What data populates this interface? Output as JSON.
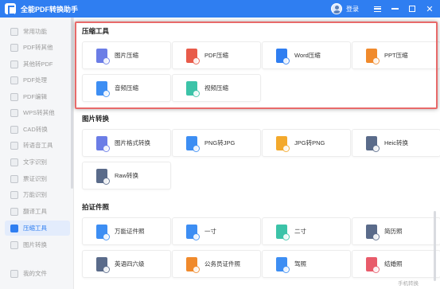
{
  "window": {
    "title": "全能PDF转换助手",
    "login_label": "登录",
    "colors": {
      "titlebar": "#2f7ef1",
      "highlight": "#e86a6a",
      "active": "#2f7ef1"
    }
  },
  "sidebar": {
    "items": [
      {
        "label": "常用功能",
        "icon": "star-icon"
      },
      {
        "label": "PDF转其他",
        "icon": "pdf-export-icon"
      },
      {
        "label": "其他转PDF",
        "icon": "pdf-import-icon"
      },
      {
        "label": "PDF处理",
        "icon": "pdf-process-icon"
      },
      {
        "label": "PDF编辑",
        "icon": "pdf-edit-icon"
      },
      {
        "label": "WPS转其他",
        "icon": "wps-icon"
      },
      {
        "label": "CAD转换",
        "icon": "cad-icon"
      },
      {
        "label": "转语音工具",
        "icon": "voice-icon"
      },
      {
        "label": "文字识别",
        "icon": "ocr-icon"
      },
      {
        "label": "票证识别",
        "icon": "ticket-icon"
      },
      {
        "label": "万能识别",
        "icon": "scan-icon"
      },
      {
        "label": "翻译工具",
        "icon": "translate-icon"
      },
      {
        "label": "压缩工具",
        "icon": "compress-icon",
        "active": true
      },
      {
        "label": "图片转换",
        "icon": "image-convert-icon"
      },
      {
        "label": "我的文件",
        "icon": "folder-icon"
      }
    ]
  },
  "sections": {
    "compress": {
      "title": "压缩工具",
      "cards": [
        {
          "label": "图片压缩",
          "icon": "image-compress-icon",
          "color": "#6b7de6",
          "tag": ""
        },
        {
          "label": "PDF压缩",
          "icon": "pdf-compress-icon",
          "color": "#e85b4a",
          "tag": ""
        },
        {
          "label": "Word压缩",
          "icon": "word-compress-icon",
          "color": "#2f7ef1",
          "tag": "W"
        },
        {
          "label": "PPT压缩",
          "icon": "ppt-compress-icon",
          "color": "#f08a2c",
          "tag": "P"
        },
        {
          "label": "音频压缩",
          "icon": "audio-compress-icon",
          "color": "#3d8ef3",
          "tag": ""
        },
        {
          "label": "视频压缩",
          "icon": "video-compress-icon",
          "color": "#3cc3a8",
          "tag": ""
        }
      ]
    },
    "image_convert": {
      "title": "图片转换",
      "cards": [
        {
          "label": "图片格式转换",
          "icon": "image-format-icon",
          "color": "#6b7de6",
          "tag": ""
        },
        {
          "label": "PNG转JPG",
          "icon": "png-to-jpg-icon",
          "color": "#3d8ef3",
          "tag": "PNG"
        },
        {
          "label": "JPG转PNG",
          "icon": "jpg-to-png-icon",
          "color": "#f3a92c",
          "tag": "JPG"
        },
        {
          "label": "Heic转换",
          "icon": "heic-icon",
          "color": "#5a6b8a",
          "tag": "Heic"
        },
        {
          "label": "Raw转换",
          "icon": "raw-icon",
          "color": "#5a6b8a",
          "tag": "Raw"
        }
      ]
    },
    "id_photo": {
      "title": "拍证件照",
      "cards": [
        {
          "label": "万能证件照",
          "icon": "id-photo-icon",
          "color": "#3d8ef3",
          "tag": ""
        },
        {
          "label": "一寸",
          "icon": "one-inch-icon",
          "color": "#3d8ef3",
          "tag": ""
        },
        {
          "label": "二寸",
          "icon": "two-inch-icon",
          "color": "#3cc3a8",
          "tag": ""
        },
        {
          "label": "简历照",
          "icon": "resume-photo-icon",
          "color": "#5a6b8a",
          "tag": ""
        },
        {
          "label": "英语四六级",
          "icon": "cet-icon",
          "color": "#5a6b8a",
          "tag": ""
        },
        {
          "label": "公务员证件照",
          "icon": "civil-servant-icon",
          "color": "#f08a2c",
          "tag": ""
        },
        {
          "label": "驾照",
          "icon": "driver-license-icon",
          "color": "#3d8ef3",
          "tag": ""
        },
        {
          "label": "结婚照",
          "icon": "wedding-photo-icon",
          "color": "#e85b6a",
          "tag": ""
        }
      ]
    }
  },
  "footer": {
    "link": "手机转换"
  }
}
